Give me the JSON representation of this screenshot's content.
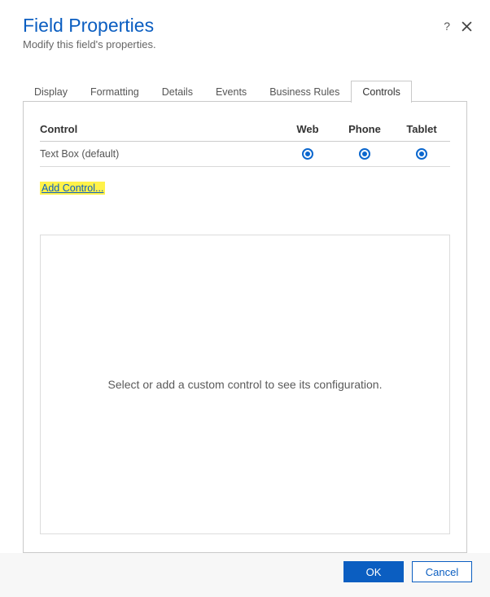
{
  "header": {
    "title": "Field Properties",
    "subtitle": "Modify this field's properties."
  },
  "tabs": {
    "items": [
      {
        "label": "Display"
      },
      {
        "label": "Formatting"
      },
      {
        "label": "Details"
      },
      {
        "label": "Events"
      },
      {
        "label": "Business Rules"
      },
      {
        "label": "Controls"
      }
    ],
    "activeIndex": 5
  },
  "controlsTab": {
    "columns": {
      "control": "Control",
      "web": "Web",
      "phone": "Phone",
      "tablet": "Tablet"
    },
    "rows": [
      {
        "name": "Text Box (default)",
        "web": true,
        "phone": true,
        "tablet": true
      }
    ],
    "addControlLabel": "Add Control...",
    "configPlaceholder": "Select or add a custom control to see its configuration."
  },
  "footer": {
    "ok": "OK",
    "cancel": "Cancel"
  }
}
